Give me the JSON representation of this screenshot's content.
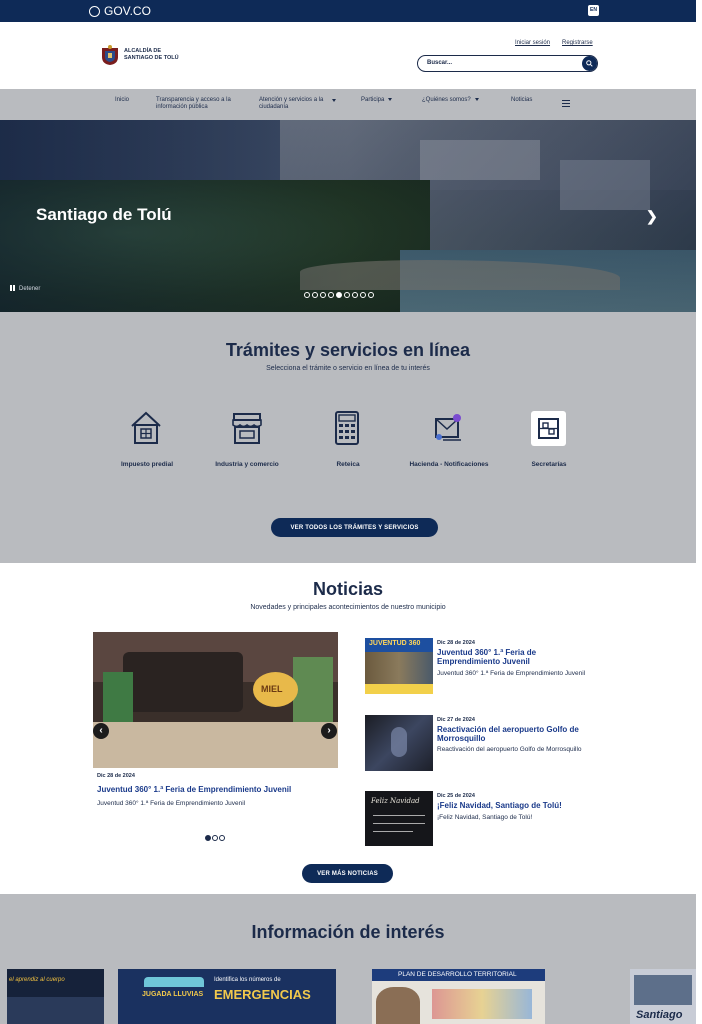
{
  "gov_bar": {
    "logo_text": "GOV.CO",
    "lang_label": "EN"
  },
  "header": {
    "brand_line1": "ALCALDÍA DE",
    "brand_line2": "SANTIAGO DE TOLÚ",
    "login_label": "Iniciar sesión",
    "register_label": "Registrarse",
    "search_placeholder": "Buscar..."
  },
  "nav": {
    "items": [
      {
        "label": "Inicio"
      },
      {
        "label": "Transparencia y acceso a la información pública"
      },
      {
        "label": "Atención y servicios a la ciudadanía"
      },
      {
        "label": "Participa"
      },
      {
        "label": "¿Quiénes somos?"
      },
      {
        "label": "Noticias"
      }
    ]
  },
  "hero": {
    "title": "Santiago de Tolú",
    "pause_label": "Detener",
    "slide_count": 9,
    "active_slide": 4
  },
  "tramites": {
    "title": "Trámites y servicios en línea",
    "subtitle": "Selecciona el trámite o servicio en línea de tu interés",
    "services": [
      {
        "label": "Impuesto predial",
        "icon": "house-icon"
      },
      {
        "label": "Industria y comercio",
        "icon": "store-icon"
      },
      {
        "label": "Reteica",
        "icon": "calculator-icon"
      },
      {
        "label": "Hacienda - Notificaciones",
        "icon": "notification-icon"
      },
      {
        "label": "Secretarías",
        "icon": "office-icon"
      }
    ],
    "cta": "VER TODOS LOS TRÁMITES Y SERVICIOS"
  },
  "noticias": {
    "title": "Noticias",
    "subtitle": "Novedades y principales acontecimientos de nuestro municipio",
    "featured": {
      "date": "Dic 28 de 2024",
      "title": "Juventud 360° 1.ª Feria de Emprendimiento Juvenil",
      "desc": "Juventud 360° 1.ª Feria de Emprendimiento Juvenil",
      "image_text": "MIEL"
    },
    "items": [
      {
        "date": "Dic 28 de 2024",
        "title": "Juventud 360° 1.ª Feria de Emprendimiento Juvenil",
        "desc": "Juventud 360° 1.ª Feria de Emprendimiento Juvenil",
        "thumb_text": "JUVENTUD 360"
      },
      {
        "date": "Dic 27 de 2024",
        "title": "Reactivación del aeropuerto Golfo de Morrosquillo",
        "desc": "Reactivación del aeropuerto Golfo de Morrosquillo",
        "thumb_text": ""
      },
      {
        "date": "Dic 25 de 2024",
        "title": "¡Feliz Navidad, Santiago de Tolú!",
        "desc": "¡Feliz Navidad, Santiago de Tolú!",
        "thumb_text": "Feliz Navidad"
      }
    ],
    "carousel_pages": 3,
    "cta": "VER MÁS NOTICIAS"
  },
  "info": {
    "title": "Información de interés",
    "cards": [
      {
        "text": "el aprendiz al cuerpo"
      },
      {
        "text": "EMERGENCIAS",
        "sub": "Identifica los números de",
        "jugada": "JUGADA LLUVIAS"
      },
      {
        "text": "PLAN DE DESARROLLO TERRITORIAL"
      },
      {
        "text": "Santiago"
      }
    ]
  },
  "colors": {
    "navy": "#0e2a57",
    "gray_band": "#b9bbbf",
    "link_blue": "#1a3a8a"
  }
}
